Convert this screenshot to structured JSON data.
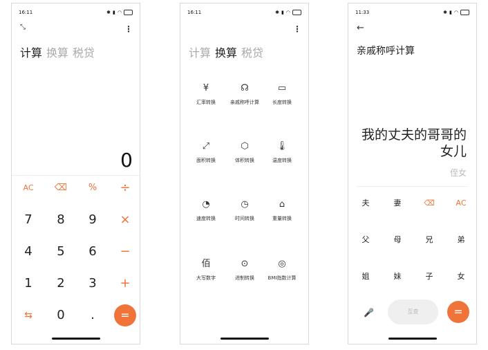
{
  "screen1": {
    "time": "16:11",
    "tabs": [
      "计算",
      "换算",
      "税贷"
    ],
    "display": "0",
    "keys": {
      "ac": "AC",
      "backspace": "⌫",
      "percent": "%",
      "divide": "÷",
      "seven": "7",
      "eight": "8",
      "nine": "9",
      "multiply": "×",
      "four": "4",
      "five": "5",
      "six": "6",
      "minus": "−",
      "one": "1",
      "two": "2",
      "three": "3",
      "plus": "+",
      "switch": "⇆",
      "zero": "0",
      "dot": ".",
      "equals": "="
    }
  },
  "screen2": {
    "time": "16:11",
    "tabs": [
      "计算",
      "换算",
      "税贷"
    ],
    "converters": [
      {
        "icon": "¥",
        "label": "汇率转换"
      },
      {
        "icon": "☊",
        "label": "亲戚称呼计算"
      },
      {
        "icon": "▭",
        "label": "长度转换"
      },
      {
        "icon": "⤢",
        "label": "面积转换"
      },
      {
        "icon": "⬡",
        "label": "体积转换"
      },
      {
        "icon": "🌡",
        "label": "温度转换"
      },
      {
        "icon": "◔",
        "label": "速度转换"
      },
      {
        "icon": "◷",
        "label": "时间转换"
      },
      {
        "icon": "⌂",
        "label": "重量转换"
      },
      {
        "icon": "佰",
        "label": "大写数字"
      },
      {
        "icon": "⊙",
        "label": "进制转换"
      },
      {
        "icon": "◎",
        "label": "BMI指数计算"
      }
    ]
  },
  "screen3": {
    "time": "11:33",
    "back": "←",
    "title": "亲戚称呼计算",
    "result_line1": "我的丈夫的哥哥的",
    "result_line2": "女儿",
    "sub_result": "侄女",
    "keys": {
      "husband": "夫",
      "wife": "妻",
      "backspace": "⌫",
      "ac": "AC",
      "father": "父",
      "mother": "母",
      "elder_brother": "兄",
      "younger_brother": "弟",
      "elder_sister": "姐",
      "younger_sister": "妹",
      "son": "子",
      "daughter": "女",
      "mic": "🎤",
      "reciprocal": "互查",
      "equals": "="
    }
  }
}
